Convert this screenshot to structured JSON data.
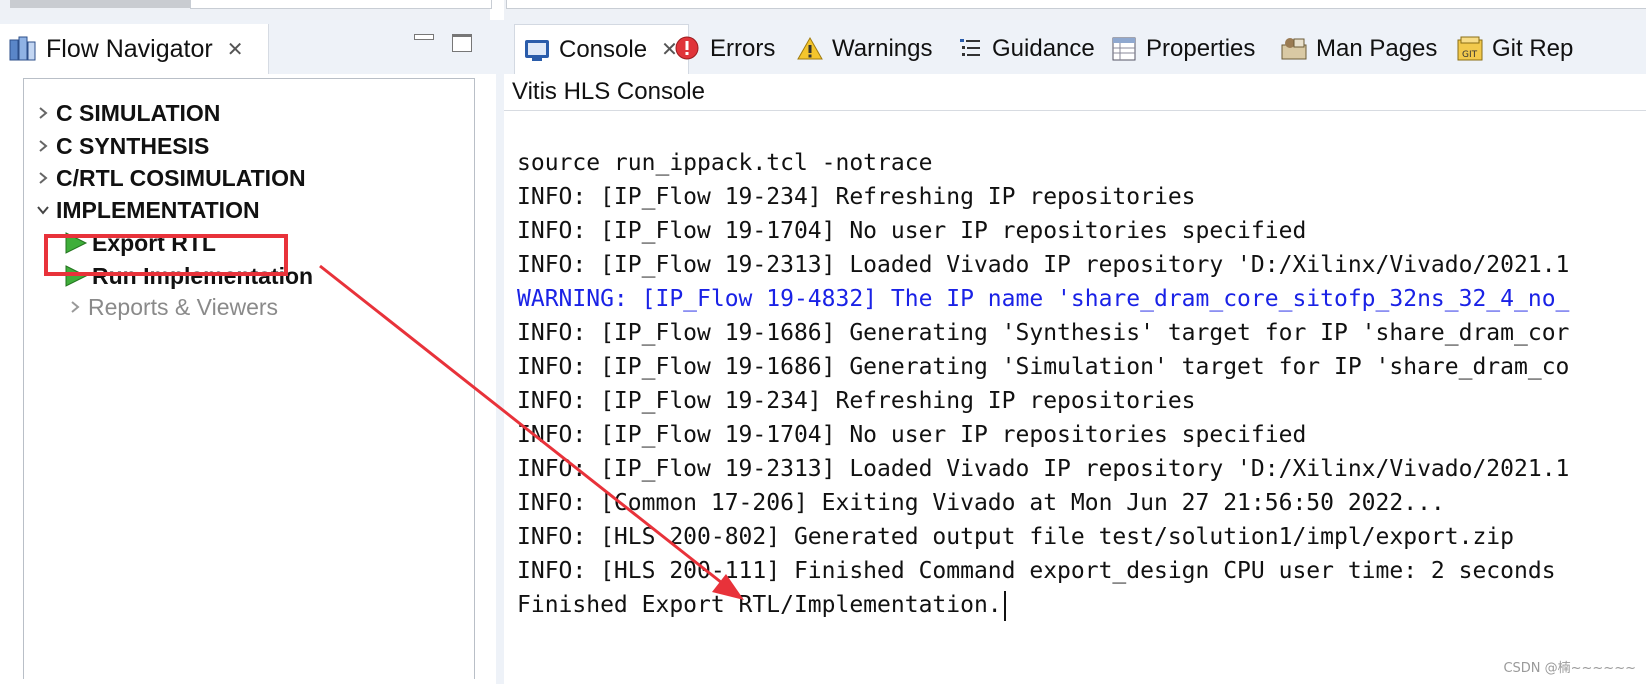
{
  "flow_navigator": {
    "tab_label": "Flow Navigator",
    "tree": [
      {
        "label": "C SIMULATION",
        "expanded": false
      },
      {
        "label": "C SYNTHESIS",
        "expanded": false
      },
      {
        "label": "C/RTL COSIMULATION",
        "expanded": false
      },
      {
        "label": "IMPLEMENTATION",
        "expanded": true
      },
      {
        "label": "Export RTL"
      },
      {
        "label": "Run Implementation"
      },
      {
        "label": "Reports & Viewers"
      }
    ]
  },
  "tabs": [
    {
      "label": "Console",
      "icon": "console-icon",
      "active": true
    },
    {
      "label": "Errors",
      "icon": "errors-icon"
    },
    {
      "label": "Warnings",
      "icon": "warnings-icon"
    },
    {
      "label": "Guidance",
      "icon": "guidance-icon"
    },
    {
      "label": "Properties",
      "icon": "properties-icon"
    },
    {
      "label": "Man Pages",
      "icon": "man-pages-icon"
    },
    {
      "label": "Git Rep",
      "icon": "git-icon"
    }
  ],
  "console": {
    "title": "Vitis HLS Console",
    "lines": [
      "source run_ippack.tcl -notrace",
      "INFO: [IP_Flow 19-234] Refreshing IP repositories",
      "INFO: [IP_Flow 19-1704] No user IP repositories specified",
      "INFO: [IP_Flow 19-2313] Loaded Vivado IP repository 'D:/Xilinx/Vivado/2021.1",
      "WARNING: [IP_Flow 19-4832] The IP name 'share_dram_core_sitofp_32ns_32_4_no_",
      "INFO: [IP_Flow 19-1686] Generating 'Synthesis' target for IP 'share_dram_cor",
      "INFO: [IP_Flow 19-1686] Generating 'Simulation' target for IP 'share_dram_co",
      "INFO: [IP_Flow 19-234] Refreshing IP repositories",
      "INFO: [IP_Flow 19-1704] No user IP repositories specified",
      "INFO: [IP_Flow 19-2313] Loaded Vivado IP repository 'D:/Xilinx/Vivado/2021.1",
      "INFO: [Common 17-206] Exiting Vivado at Mon Jun 27 21:56:50 2022...",
      "INFO: [HLS 200-802] Generated output file test/solution1/impl/export.zip",
      "INFO: [HLS 200-111] Finished Command export_design CPU user time: 2 seconds",
      "Finished Export RTL/Implementation."
    ]
  },
  "colors": {
    "warning_text": "#1a22e6",
    "highlight_red": "#e8323a"
  },
  "watermark": "CSDN @楠~~~~~~"
}
